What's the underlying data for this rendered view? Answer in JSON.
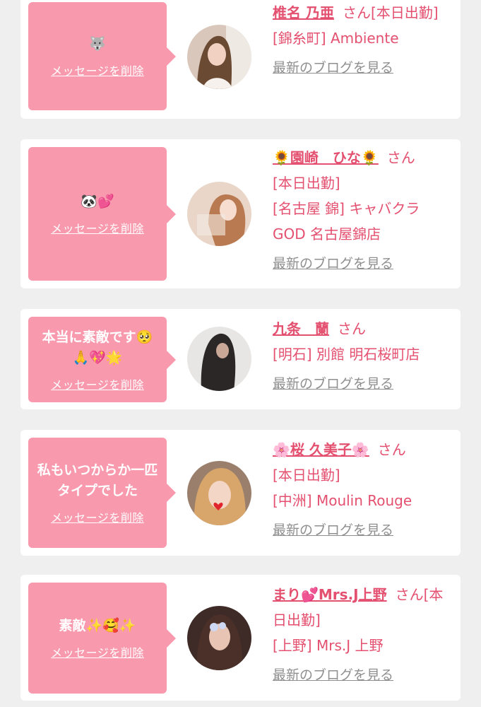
{
  "delete_label": "メッセージを削除",
  "blog_label": "最新のブログを見る",
  "honorific": "さん",
  "colors": {
    "bubble": "#f899ad",
    "accent": "#e4506f",
    "link_gray": "#8f8f8f",
    "background": "#efefef"
  },
  "items": [
    {
      "message": "🐺",
      "name": "椎名 乃亜",
      "status": "[本日出勤]",
      "shop": "[錦糸町] Ambiente",
      "avatar_icon": "woman-portrait-icon"
    },
    {
      "message": "🐼💕",
      "name": "🌻園崎　ひな🌻",
      "status": "[本日出勤]",
      "shop": "[名古屋 錦] キャバクラGOD 名古屋錦店",
      "avatar_icon": "woman-portrait-icon"
    },
    {
      "message": "本当に素敵です🥺🙏💖🌟",
      "name": "九条　蘭",
      "status": "",
      "shop": "[明石] 別館 明石桜町店",
      "avatar_icon": "woman-portrait-icon"
    },
    {
      "message": "私もいつからか一匹タイプでした",
      "name": "🌸桜 久美子🌸",
      "status": "[本日出勤]",
      "shop": "[中洲] Moulin Rouge",
      "avatar_icon": "woman-portrait-icon"
    },
    {
      "message": "素敵✨🥰✨",
      "name": "まり💕Mrs.J上野",
      "status": "[本日出勤]",
      "shop": "[上野] Mrs.J 上野",
      "avatar_icon": "woman-portrait-icon"
    }
  ]
}
